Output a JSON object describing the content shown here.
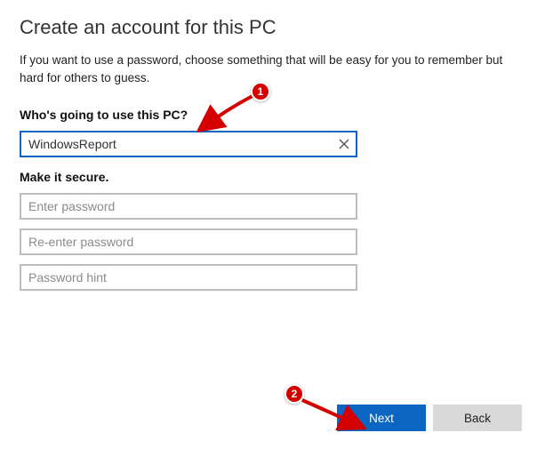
{
  "header": {
    "title": "Create an account for this PC",
    "subtitle": "If you want to use a password, choose something that will be easy for you to remember but hard for others to guess."
  },
  "user_section": {
    "label": "Who's going to use this PC?",
    "username_value": "WindowsReport"
  },
  "secure_section": {
    "label": "Make it secure.",
    "password_placeholder": "Enter password",
    "password_confirm_placeholder": "Re-enter password",
    "hint_placeholder": "Password hint"
  },
  "buttons": {
    "next": "Next",
    "back": "Back"
  },
  "annotations": {
    "step1": "1",
    "step2": "2"
  }
}
